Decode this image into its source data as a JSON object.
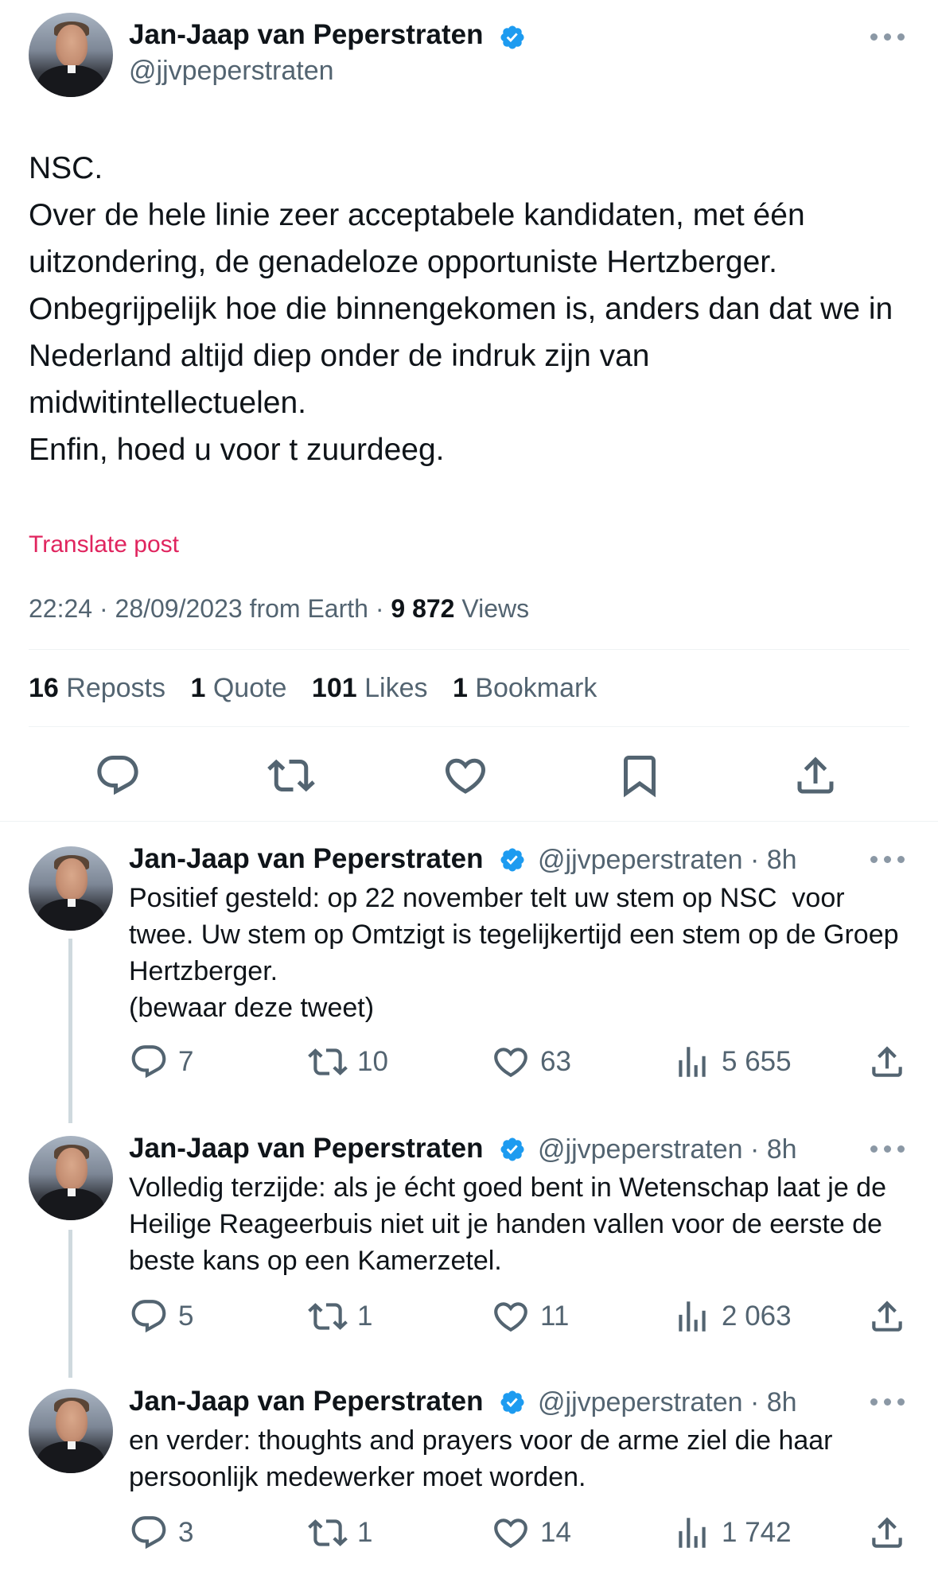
{
  "main_post": {
    "author_name": "Jan-Jaap van Peperstraten",
    "handle": "@jjvpeperstraten",
    "text": "NSC.\nOver de hele linie zeer acceptabele kandidaten, met één uitzondering, de genadeloze opportuniste Hertzberger.\nOnbegrijpelijk hoe die binnengekomen is, anders dan dat we in Nederland altijd diep onder de indruk zijn van midwitintellectuelen.\nEnfin, hoed u voor t zuurdeeg.",
    "translate_label": "Translate post",
    "timestamp": "22:24 · 28/09/2023 from Earth · ",
    "views_count": "9 872",
    "views_label": " Views",
    "stats": {
      "reposts_count": "16",
      "reposts_label": " Reposts",
      "quote_count": "1",
      "quote_label": " Quote",
      "likes_count": "101",
      "likes_label": " Likes",
      "bookmark_count": "1",
      "bookmark_label": " Bookmark"
    }
  },
  "replies": [
    {
      "author_name": "Jan-Jaap van Peperstraten",
      "handle_time": "@jjvpeperstraten · 8h",
      "text": "Positief gesteld: op 22 november telt uw stem op NSC  voor twee. Uw stem op Omtzigt is tegelijkertijd een stem op de Groep Hertzberger.\n(bewaar deze tweet)",
      "replies": "7",
      "reposts": "10",
      "likes": "63",
      "views": "5 655"
    },
    {
      "author_name": "Jan-Jaap van Peperstraten",
      "handle_time": "@jjvpeperstraten · 8h",
      "text": "Volledig terzijde: als je écht goed bent in Wetenschap laat je de Heilige Reageerbuis niet uit je handen vallen voor de eerste de beste kans op een Kamerzetel.",
      "replies": "5",
      "reposts": "1",
      "likes": "11",
      "views": "2 063"
    },
    {
      "author_name": "Jan-Jaap van Peperstraten",
      "handle_time": "@jjvpeperstraten · 8h",
      "text": "en verder: thoughts and prayers voor de arme ziel die haar persoonlijk medewerker moet worden.",
      "replies": "3",
      "reposts": "1",
      "likes": "14",
      "views": "1 742"
    }
  ],
  "colors": {
    "verified": "#1d9bf0",
    "translate": "#e0245e",
    "secondary_text": "#536471",
    "primary_text": "#0f1419"
  },
  "icons": [
    "verified-badge-icon",
    "more-icon",
    "reply-icon",
    "repost-icon",
    "like-icon",
    "bookmark-icon",
    "share-icon",
    "views-icon"
  ]
}
